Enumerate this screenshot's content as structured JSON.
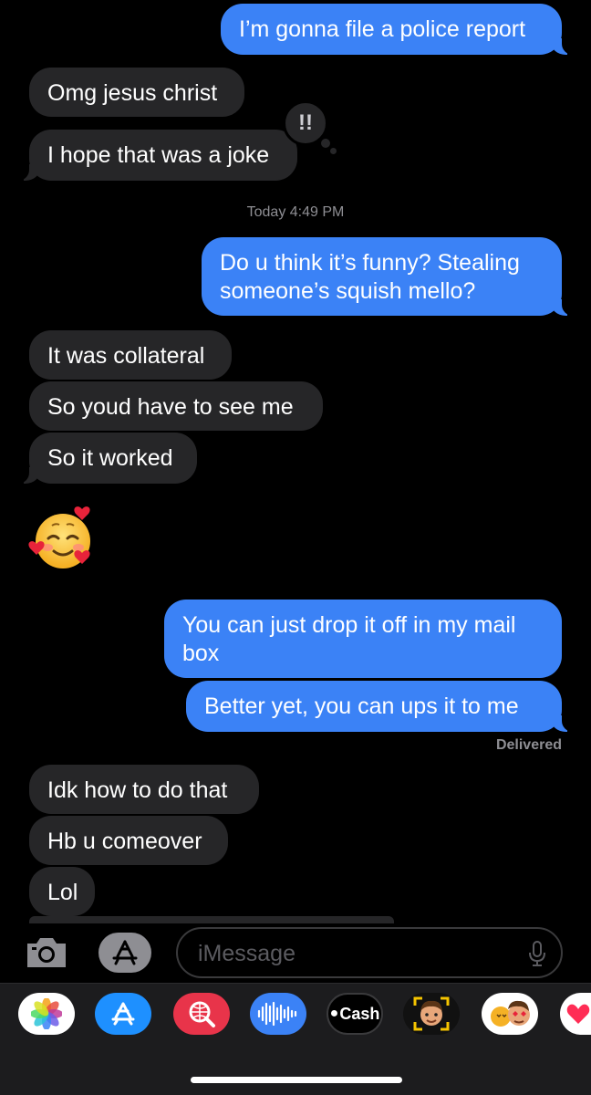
{
  "messages": {
    "m1": "I’m gonna file a police report",
    "m2": "Omg jesus christ",
    "m3": "I hope that was a joke",
    "m4": "Do u think it’s funny? Stealing someone’s squish mello?",
    "m5": "It was collateral",
    "m6": "So youd have to see me",
    "m7": "So it worked",
    "m8": "You can just drop it off in my mail box",
    "m9": "Better yet, you can ups it to me",
    "m10": "Idk how to do that",
    "m11": "Hb u comeover",
    "m12": "Lol"
  },
  "tapback": "!!",
  "timestamp": {
    "day": "Today",
    "time": "4:49 PM"
  },
  "status": "Delivered",
  "input": {
    "placeholder": "iMessage"
  },
  "apps": [
    "Photos",
    "App Store",
    "Images",
    "Audio",
    "Cash",
    "Memoji",
    "Memoji Stickers",
    "Digital Touch"
  ],
  "apple_cash_label": "Cash",
  "colors": {
    "outgoing": "#3b82f6",
    "incoming": "#262628",
    "background": "#000000"
  }
}
